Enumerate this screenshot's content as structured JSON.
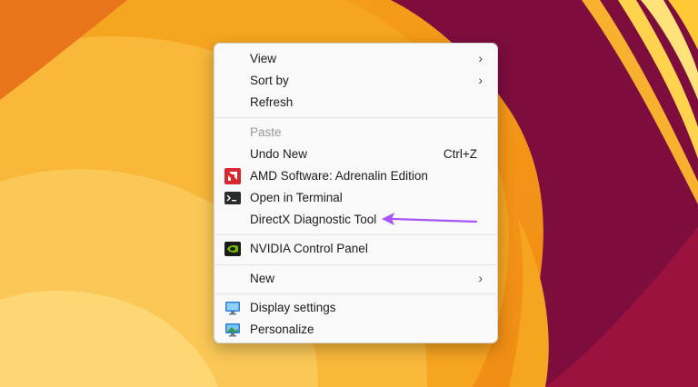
{
  "menu": {
    "view": "View",
    "sort_by": "Sort by",
    "refresh": "Refresh",
    "paste": "Paste",
    "undo_new": "Undo New",
    "undo_shortcut": "Ctrl+Z",
    "amd": "AMD Software: Adrenalin Edition",
    "terminal": "Open in Terminal",
    "directx": "DirectX Diagnostic Tool",
    "nvidia": "NVIDIA Control Panel",
    "new": "New",
    "display": "Display settings",
    "personalize": "Personalize"
  },
  "icons": {
    "submenu": "chevron-right-icon",
    "amd": "amd-logo-icon",
    "terminal": "terminal-icon",
    "nvidia": "nvidia-logo-icon",
    "display": "monitor-icon",
    "personalize": "personalize-icon"
  },
  "colors": {
    "annotation_arrow": "#a855f7",
    "amd_red": "#d7282f",
    "nvidia_green": "#76b900"
  }
}
